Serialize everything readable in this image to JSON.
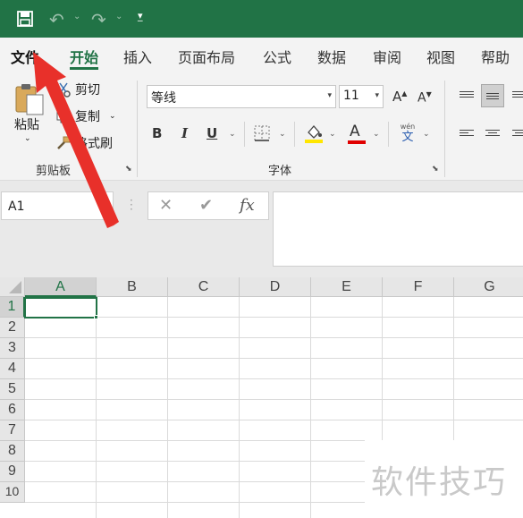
{
  "quick_access": {
    "icons": [
      "save-icon",
      "undo-icon",
      "redo-icon",
      "customize-toolbar-icon"
    ],
    "accent_color": "#217346"
  },
  "tabs": [
    {
      "label": "文件"
    },
    {
      "label": "开始"
    },
    {
      "label": "插入"
    },
    {
      "label": "页面布局"
    },
    {
      "label": "公式"
    },
    {
      "label": "数据"
    },
    {
      "label": "审阅"
    },
    {
      "label": "视图"
    },
    {
      "label": "帮助"
    }
  ],
  "active_tab": "开始",
  "ribbon": {
    "clipboard": {
      "paste_label": "粘贴",
      "cut_label": "剪切",
      "copy_label": "复制",
      "format_painter_label": "格式刷",
      "group_label": "剪贴板"
    },
    "font": {
      "font_name": "等线",
      "font_size": "11",
      "grow_font_glyph": "A",
      "shrink_font_glyph": "A",
      "bold_glyph": "B",
      "italic_glyph": "I",
      "underline_glyph": "U",
      "font_color_glyph": "A",
      "fill_color": "#ffe600",
      "font_color": "#e00000",
      "phonetic_top": "wén",
      "phonetic_bottom": "文",
      "group_label": "字体"
    }
  },
  "formula_bar": {
    "name_box": "A1",
    "cancel_glyph": "✕",
    "enter_glyph": "✔",
    "function_glyph": "fx",
    "formula": ""
  },
  "grid": {
    "columns": [
      "A",
      "B",
      "C",
      "D",
      "E",
      "F",
      "G"
    ],
    "rows": [
      "1",
      "2",
      "3",
      "4",
      "5",
      "6",
      "7",
      "8",
      "9",
      "10"
    ],
    "selected_cell": "A1"
  },
  "watermark": "软件技巧"
}
